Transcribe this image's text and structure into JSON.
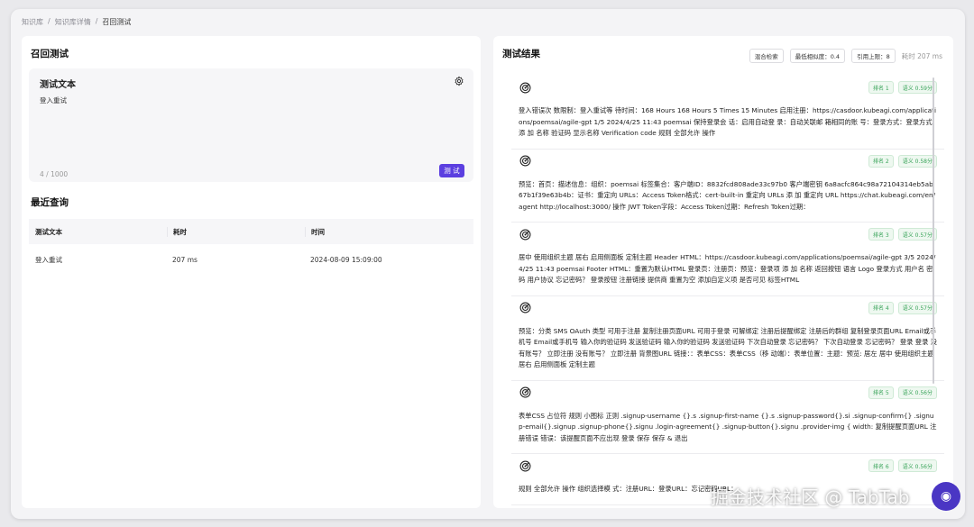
{
  "breadcrumb": [
    "知识库",
    "知识库详情",
    "召回测试"
  ],
  "left": {
    "title": "召回测试",
    "input": {
      "label": "测试文本",
      "value": "登入重试",
      "count": "4 / 1000",
      "button": "测 试"
    },
    "recent_title": "最近查询",
    "table": {
      "headers": [
        "测试文本",
        "耗时",
        "时间"
      ],
      "rows": [
        [
          "登入重试",
          "207 ms",
          "2024-08-09 15:09:00"
        ]
      ]
    }
  },
  "right": {
    "title": "测试结果",
    "chips": [
      "混合检索",
      "最低相似度：0.4",
      "引用上限：8"
    ],
    "time": "耗时 207 ms",
    "results": [
      {
        "rank": "排名 1",
        "score": "语义 0.59分",
        "text": "登入错误次 数限制：登入重试等 待时间：168 Hours 168 Hours 5 Times 15 Minutes 启用注册：https://casdoor.kubeagi.com/applications/poemsai/agile-gpt 1/5 2024/4/25 11:43 poemsai 保持登录会 话：启用自动登 录：自动关联邮 箱相同的账 号：登录方式：登录方式 添 加 名称 验证码 显示名称 Verification code 规则 全部允许 操作"
      },
      {
        "rank": "排名 2",
        "score": "语义 0.58分",
        "text": "预览：首页：描述信息：组织：poemsai 标签集合：客户端ID：8832fcd808ade33c97b0 客户端密钥 6a8acfc864c98a72104314eb5ab67b1f39e63b4b：证书：重定向 URLs：Access Token格式：cert-built-in 重定向 URLs 添 加 重定向 URL https://chat.kubeagi.com/en/agent http://localhost:3000/ 操作 JWT Token字段：Access Token过期：Refresh Token过期："
      },
      {
        "rank": "排名 3",
        "score": "语义 0.57分",
        "text": "居中 使用组织主题 居右 启用侧面板 定制主题 Header HTML：https://casdoor.kubeagi.com/applications/poemsai/agile-gpt 3/5 2024/4/25 11:43 poemsai Footer HTML：重置为默认HTML 登录页：注册页：预览：登录项 添 加 名称 返回按钮 语言 Logo 登录方式 用户名 密码 用户协议 忘记密码？ 登录按钮 注册链接 提供商 重置为空 添加自定义项 是否可见 标签HTML"
      },
      {
        "rank": "排名 4",
        "score": "语义 0.57分",
        "text": "预览：分类 SMS OAuth 类型 可用于注册 复制注册页面URL 可用于登录 可解绑定 注册后提醒绑定 注册后的群组 复制登录页面URL Email或手机号 Email或手机号 输入你的验证码 发送验证码 输入你的验证码 发送验证码 下次自动登录 忘记密码？ 下次自动登录 忘记密码？ 登录 登录 没有账号？ 立即注册 没有账号？ 立即注册 背景图URL 链接：：表单CSS：表单CSS（移 动端）：表单位置：主题：预览: 居左 居中 使用组织主题 居右 启用侧面板 定制主题"
      },
      {
        "rank": "排名 5",
        "score": "语义 0.56分",
        "text": "表单CSS 占位符 规则 小图标 正则 .signup-username {}.s .signup-first-name {}.s .signup-password{}.si .signup-confirm{} .signup-email{}.signup .signup-phone{}.signu .login-agreement{} .signup-button{}.signu .provider-img { width: 复制提醒页面URL 注册错误 错误：该提醒页面不应出现 登录 保存 保存 & 退出"
      },
      {
        "rank": "排名 6",
        "score": "语义 0.56分",
        "text": "规则 全部允许 操作 组织选择模 式：注册URL：登录URL：忘记密码URL："
      }
    ]
  },
  "watermark": "掘金技术社区 @ TabTab",
  "accent": "#5b3fe0"
}
